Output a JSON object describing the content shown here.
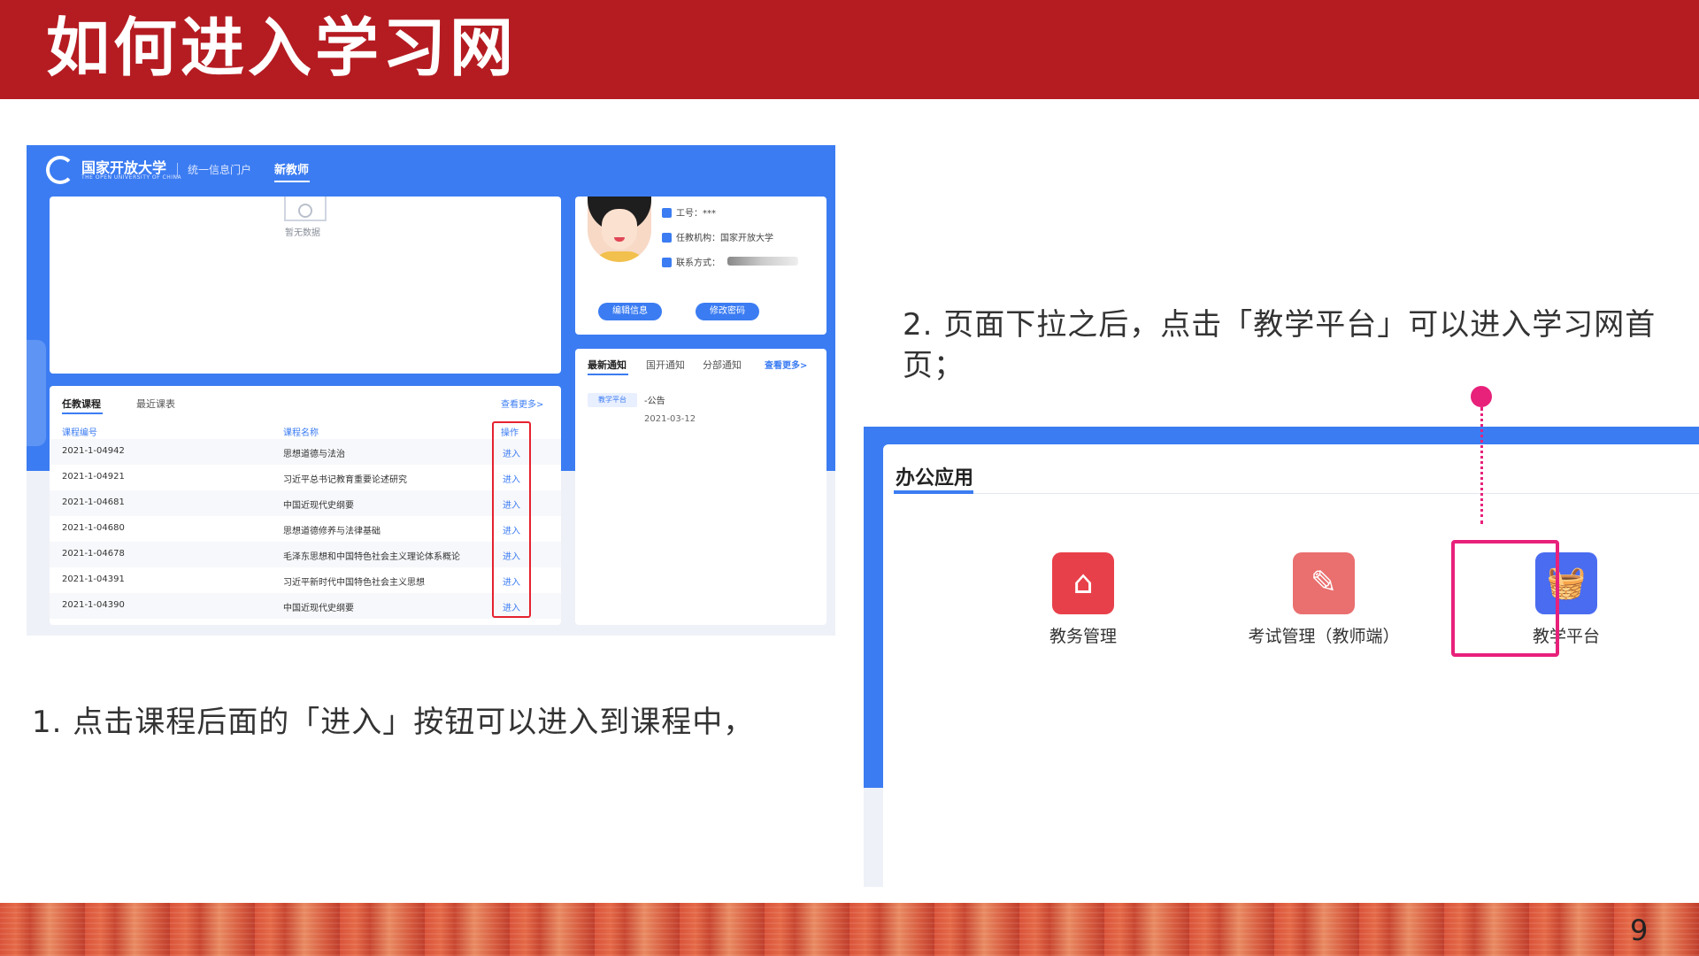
{
  "slide": {
    "title": "如何进入学习网",
    "page_number": "9",
    "step1": "1. 点击课程后面的「进入」按钮可以进入到课程中，",
    "step2": "2. 页面下拉之后，点击「教学平台」可以进入学习网首页；"
  },
  "portal": {
    "brand": "国家开放大学",
    "brand_en": "THE OPEN UNIVERSITY OF CHINA",
    "nav_portal": "统一信息门户",
    "nav_new_teacher": "新教师",
    "empty_text": "暂无数据",
    "profile": {
      "id_label": "工号：",
      "id_value": "***",
      "org_label": "任教机构：",
      "org_value": "国家开放大学",
      "contact_label": "联系方式：",
      "edit_button": "编辑信息",
      "password_button": "修改密码"
    },
    "courses": {
      "tab_teaching": "任教课程",
      "tab_recent": "最近课表",
      "more": "查看更多>",
      "headers": {
        "code": "课程编号",
        "name": "课程名称",
        "op": "操作"
      },
      "rows": [
        {
          "code": "2021-1-04942",
          "name": "思想道德与法治",
          "op": "进入"
        },
        {
          "code": "2021-1-04921",
          "name": "习近平总书记教育重要论述研究",
          "op": "进入"
        },
        {
          "code": "2021-1-04681",
          "name": "中国近现代史纲要",
          "op": "进入"
        },
        {
          "code": "2021-1-04680",
          "name": "思想道德修养与法律基础",
          "op": "进入"
        },
        {
          "code": "2021-1-04678",
          "name": "毛泽东思想和中国特色社会主义理论体系概论",
          "op": "进入"
        },
        {
          "code": "2021-1-04391",
          "name": "习近平新时代中国特色社会主义思想",
          "op": "进入"
        },
        {
          "code": "2021-1-04390",
          "name": "中国近现代史纲要",
          "op": "进入"
        }
      ]
    },
    "notices": {
      "tab_latest": "最新通知",
      "tab_open": "国开通知",
      "tab_branch": "分部通知",
      "more": "查看更多>",
      "item_tag": "教学平台",
      "item_title": "-公告",
      "item_date": "2021-03-12"
    }
  },
  "office": {
    "title": "办公应用",
    "apps": [
      {
        "label": "教务管理",
        "icon": "house-icon"
      },
      {
        "label": "考试管理（教师端）",
        "icon": "exam-icon"
      },
      {
        "label": "教学平台",
        "icon": "basket-icon"
      }
    ]
  },
  "colors": {
    "header_red": "#b51c22",
    "portal_blue": "#3b7cf2",
    "highlight_red": "#e5222f",
    "highlight_pink": "#e8217b"
  }
}
